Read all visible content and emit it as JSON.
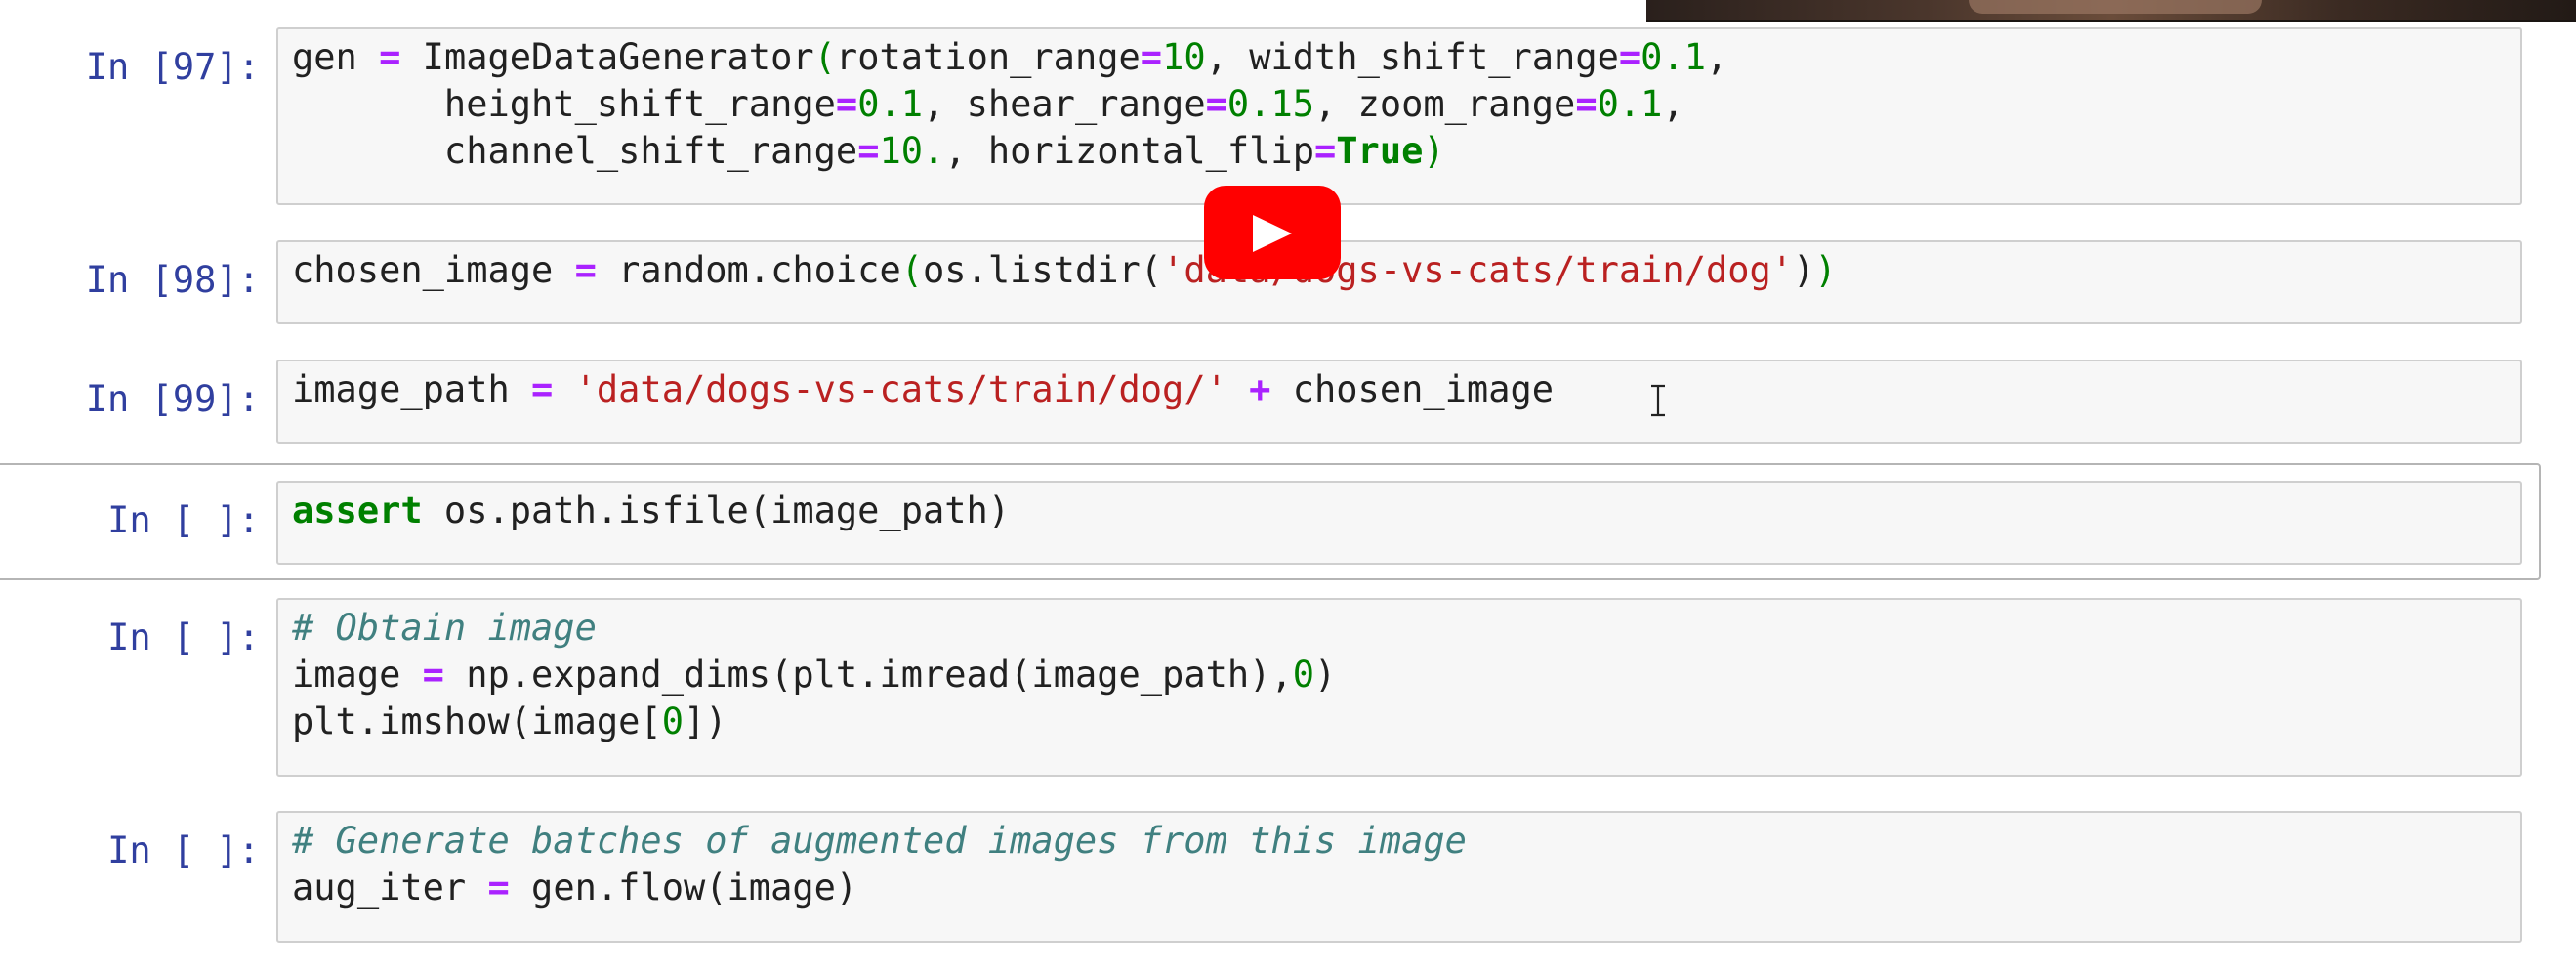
{
  "cells": [
    {
      "prompt": "In [97]:",
      "lines": [
        [
          [
            "p",
            "gen "
          ],
          [
            "o",
            "="
          ],
          [
            "p",
            " ImageDataGenerator"
          ],
          [
            "n",
            "("
          ],
          [
            "p",
            "rotation_range"
          ],
          [
            "o",
            "="
          ],
          [
            "n",
            "10"
          ],
          [
            "p",
            ", width_shift_range"
          ],
          [
            "o",
            "="
          ],
          [
            "n",
            "0.1"
          ],
          [
            "p",
            ","
          ]
        ],
        [
          [
            "p",
            "       height_shift_range"
          ],
          [
            "o",
            "="
          ],
          [
            "n",
            "0.1"
          ],
          [
            "p",
            ", shear_range"
          ],
          [
            "o",
            "="
          ],
          [
            "n",
            "0.15"
          ],
          [
            "p",
            ", zoom_range"
          ],
          [
            "o",
            "="
          ],
          [
            "n",
            "0.1"
          ],
          [
            "p",
            ","
          ]
        ],
        [
          [
            "p",
            "       channel_shift_range"
          ],
          [
            "o",
            "="
          ],
          [
            "n",
            "10."
          ],
          [
            "p",
            ", horizontal_flip"
          ],
          [
            "o",
            "="
          ],
          [
            "k",
            "True"
          ],
          [
            "n",
            ")"
          ]
        ]
      ]
    },
    {
      "prompt": "In [98]:",
      "lines": [
        [
          [
            "p",
            "chosen_image "
          ],
          [
            "o",
            "="
          ],
          [
            "p",
            " random.choice"
          ],
          [
            "n",
            "("
          ],
          [
            "p",
            "os.listdir("
          ],
          [
            "s",
            "'data/dogs-vs-cats/train/dog'"
          ],
          [
            "p",
            ")"
          ],
          [
            "n",
            ")"
          ]
        ]
      ]
    },
    {
      "prompt": "In [99]:",
      "lines": [
        [
          [
            "p",
            "image_path "
          ],
          [
            "o",
            "="
          ],
          [
            "p",
            " "
          ],
          [
            "s",
            "'data/dogs-vs-cats/train/dog/'"
          ],
          [
            "p",
            " "
          ],
          [
            "o",
            "+"
          ],
          [
            "p",
            " chosen_image"
          ]
        ]
      ]
    },
    {
      "prompt": "In [ ]:",
      "selected": true,
      "lines": [
        [
          [
            "k",
            "assert"
          ],
          [
            "p",
            " os.path.isfile(image_path)"
          ]
        ]
      ]
    },
    {
      "prompt": "In [ ]:",
      "lines": [
        [
          [
            "c",
            "# Obtain image"
          ]
        ],
        [
          [
            "p",
            "image "
          ],
          [
            "o",
            "="
          ],
          [
            "p",
            " np.expand_dims(plt.imread(image_path),"
          ],
          [
            "n",
            "0"
          ],
          [
            "p",
            ")"
          ]
        ],
        [
          [
            "p",
            "plt.imshow(image["
          ],
          [
            "n",
            "0"
          ],
          [
            "p",
            "])"
          ]
        ]
      ]
    },
    {
      "prompt": "In [ ]:",
      "lines": [
        [
          [
            "c",
            "# Generate batches of augmented images from this image"
          ]
        ],
        [
          [
            "p",
            "aug_iter "
          ],
          [
            "o",
            "="
          ],
          [
            "p",
            " gen.flow(image)"
          ]
        ]
      ]
    }
  ],
  "overlays": {
    "play_button": "youtube-play-icon",
    "cursor": "text-cursor-icon",
    "play_color": "#ff0000"
  }
}
